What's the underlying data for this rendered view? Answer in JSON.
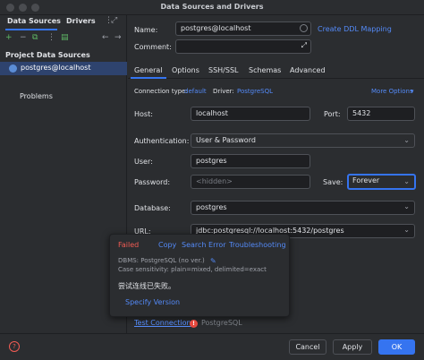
{
  "window": {
    "title": "Data Sources and Drivers"
  },
  "left": {
    "tabs": [
      "Data Sources",
      "Drivers"
    ],
    "toolbar": {
      "add": "+",
      "remove": "−",
      "duplicate": "⧉",
      "more": "⋮",
      "sql": "▤",
      "back": "←",
      "forward": "→"
    },
    "section_title": "Project Data Sources",
    "datasource": "postgres@localhost",
    "problems": "Problems"
  },
  "right": {
    "name_label": "Name:",
    "name_value": "postgres@localhost",
    "ddl_link": "Create DDL Mapping",
    "comment_label": "Comment:",
    "tabs": [
      "General",
      "Options",
      "SSH/SSL",
      "Schemas",
      "Advanced"
    ],
    "conn_type_label": "Connection type:",
    "conn_type_value": "default",
    "driver_label": "Driver:",
    "driver_value": "PostgreSQL",
    "more_options": "More Options",
    "host_label": "Host:",
    "host_value": "localhost",
    "port_label": "Port:",
    "port_value": "5432",
    "auth_label": "Authentication:",
    "auth_value": "User & Password",
    "user_label": "User:",
    "user_value": "postgres",
    "password_label": "Password:",
    "password_placeholder": "<hidden>",
    "save_label": "Save:",
    "save_value": "Forever",
    "database_label": "Database:",
    "database_value": "postgres",
    "url_label": "URL:",
    "url_value": "jdbc:postgresql://localhost:5432/postgres"
  },
  "popup": {
    "status": "Failed",
    "copy": "Copy",
    "search_error": "Search Error",
    "troubleshooting": "Troubleshooting",
    "dbms": "DBMS: PostgreSQL (no ver.)",
    "case": "Case sensitivity: plain=mixed, delimited=exact",
    "message": "尝试连线已失败。",
    "specify_version": "Specify Version"
  },
  "footer": {
    "test_connection": "Test Connection",
    "driver_status": "PostgreSQL",
    "help": "?",
    "cancel": "Cancel",
    "apply": "Apply",
    "ok": "OK"
  },
  "colors": {
    "accent": "#3574f0",
    "link": "#548af7",
    "error": "#f25c54",
    "background": "#2b2d30"
  }
}
